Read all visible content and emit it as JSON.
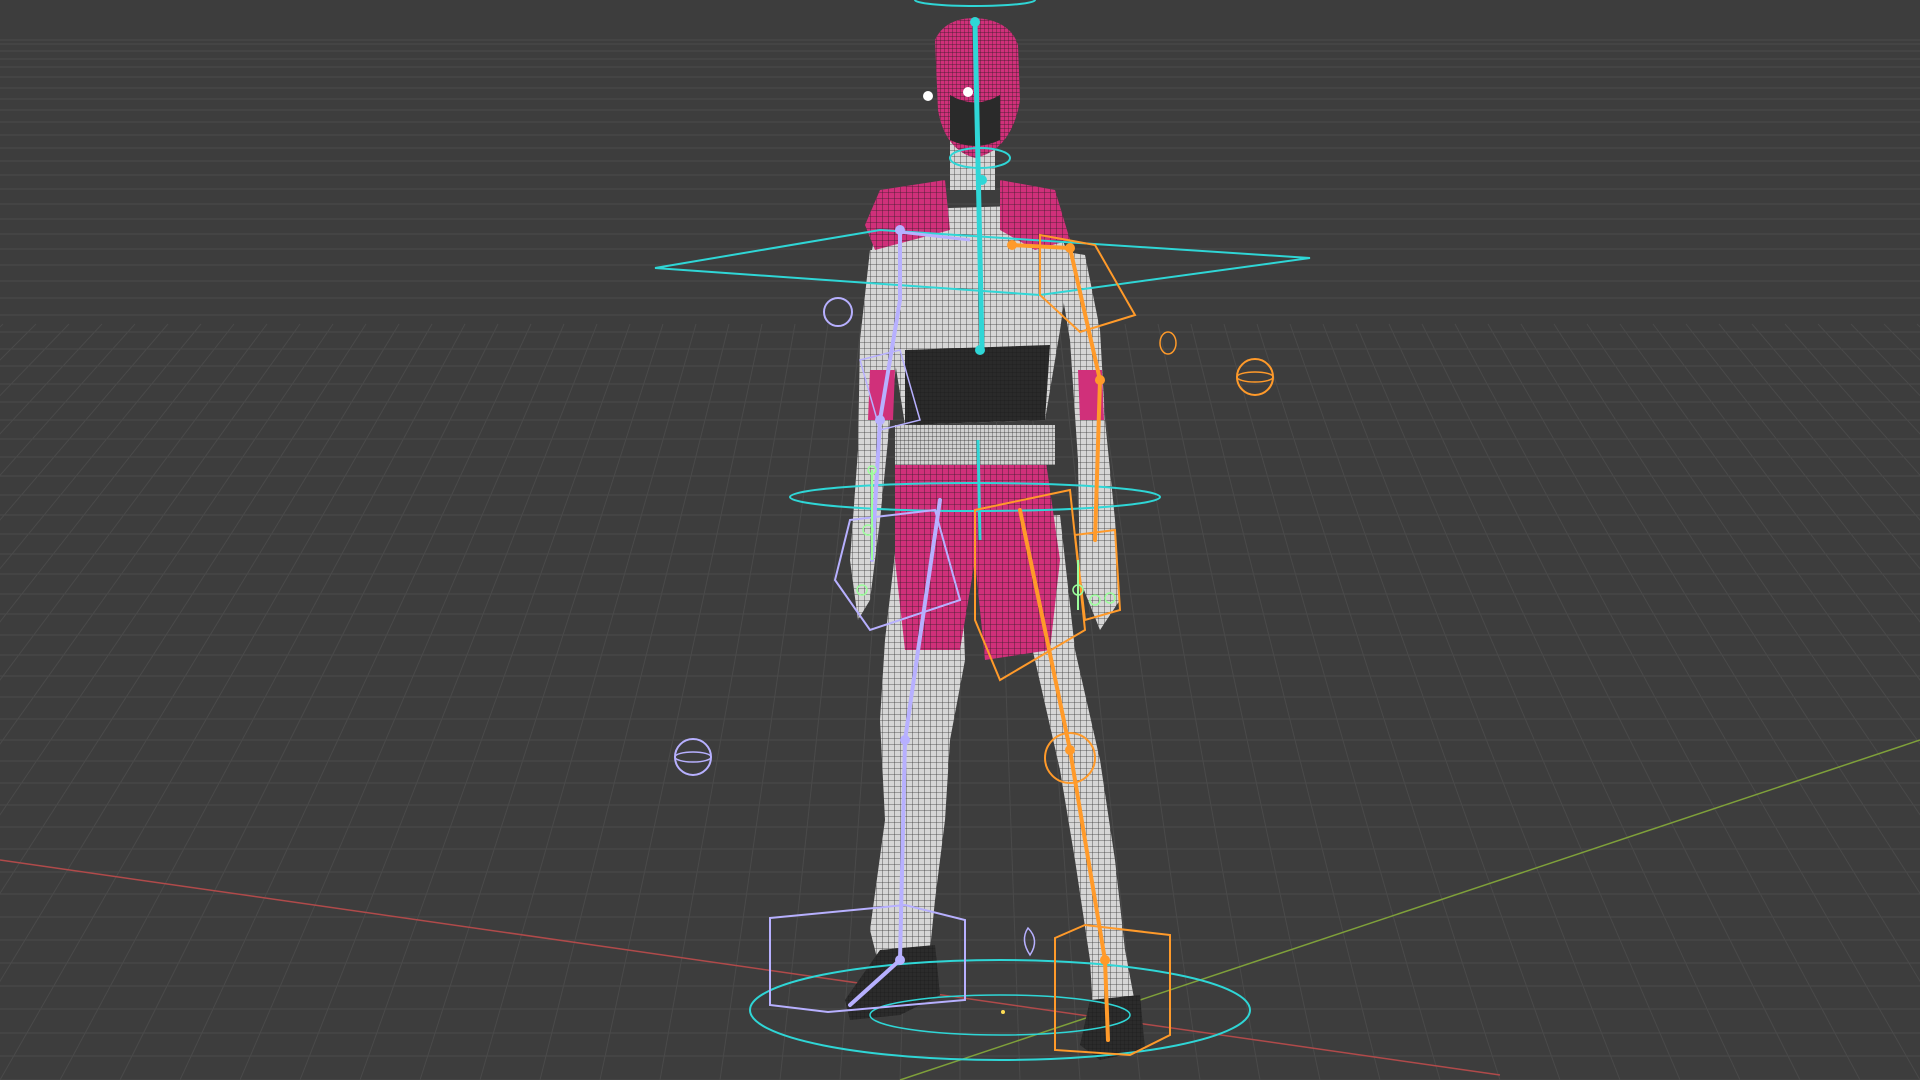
{
  "viewport": {
    "background": "#3d3d3d",
    "grid_color": "#4a4a4a",
    "x_axis_color": "#b04a4a",
    "y_axis_color": "#7fa03a",
    "mesh_colors": {
      "body": "#d6d6d6",
      "accent": "#d0307a",
      "wire": "#1a1a1a"
    },
    "rig_colors": {
      "center": "#2fd6d6",
      "left": "#b7b0ff",
      "right": "#ff9a2a",
      "finger": "#9cff9c"
    }
  }
}
